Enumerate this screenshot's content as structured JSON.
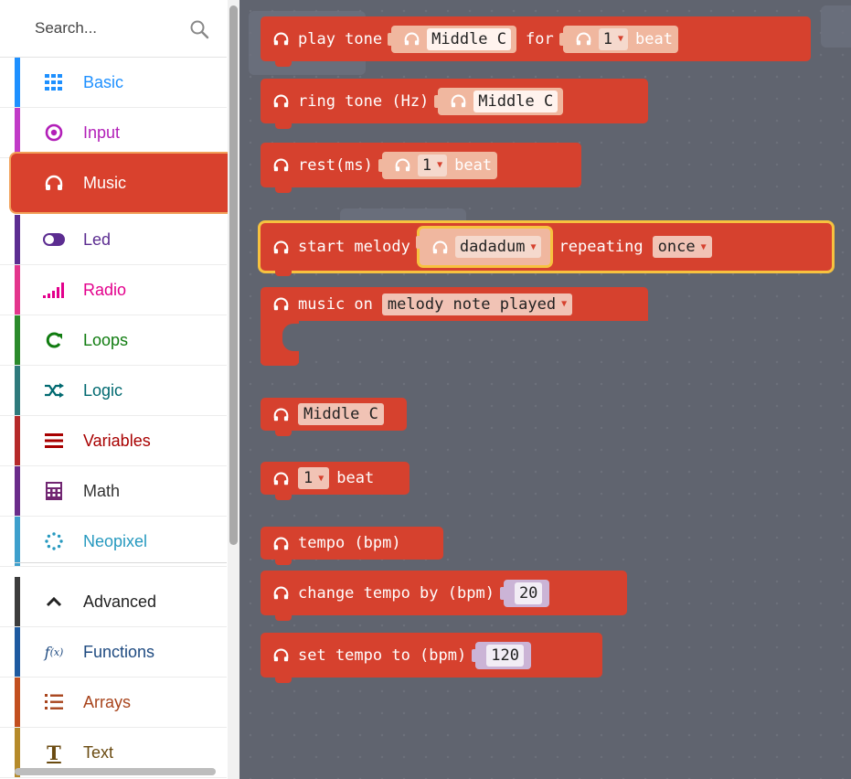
{
  "search": {
    "placeholder": "Search..."
  },
  "categories": [
    {
      "label": "Basic",
      "icon": "grid-icon",
      "color": "#1e90ff"
    },
    {
      "label": "Input",
      "icon": "target-icon",
      "color": "#d400d4"
    },
    {
      "label": "Music",
      "icon": "headphones-icon",
      "color": "#e63022",
      "selected": true
    },
    {
      "label": "Led",
      "icon": "toggle-icon",
      "color": "#5c2d91"
    },
    {
      "label": "Radio",
      "icon": "signal-icon",
      "color": "#e3008c"
    },
    {
      "label": "Loops",
      "icon": "refresh-icon",
      "color": "#00aa00"
    },
    {
      "label": "Logic",
      "icon": "shuffle-icon",
      "color": "#00a4a6"
    },
    {
      "label": "Variables",
      "icon": "lines-icon",
      "color": "#dc143c"
    },
    {
      "label": "Math",
      "icon": "calculator-icon",
      "color": "#9400d3"
    },
    {
      "label": "Neopixel",
      "icon": "dotted-circle-icon",
      "color": "#2699bf"
    },
    {
      "label": "Advanced",
      "icon": "chevron-up-icon",
      "color": "#3c3c3c"
    },
    {
      "label": "Functions",
      "icon": "function-icon",
      "color": "#005a9e"
    },
    {
      "label": "Arrays",
      "icon": "list-icon",
      "color": "#e65722"
    },
    {
      "label": "Text",
      "icon": "text-icon",
      "color": "#b8860b"
    }
  ],
  "blocks": {
    "play_tone": {
      "label": "play tone",
      "note": "Middle C",
      "for": "for",
      "beat_value": "1",
      "beat": "beat"
    },
    "ring_tone": {
      "label": "ring tone (Hz)",
      "note": "Middle C"
    },
    "rest": {
      "label": "rest(ms)",
      "beat_value": "1",
      "beat": "beat"
    },
    "start_melody": {
      "label": "start melody",
      "melody": "dadadum",
      "repeating": "repeating",
      "mode": "once"
    },
    "music_on": {
      "label": "music on",
      "event": "melody note played"
    },
    "note_value": {
      "note": "Middle C"
    },
    "beat_value": {
      "value": "1",
      "beat": "beat"
    },
    "tempo": {
      "label": "tempo (bpm)"
    },
    "change_tempo": {
      "label": "change tempo by (bpm)",
      "value": "20"
    },
    "set_tempo": {
      "label": "set tempo to (bpm)",
      "value": "120"
    }
  },
  "colors": {
    "music": "#d6412e",
    "workspace": "#60646f",
    "highlight": "#f7c23f"
  }
}
